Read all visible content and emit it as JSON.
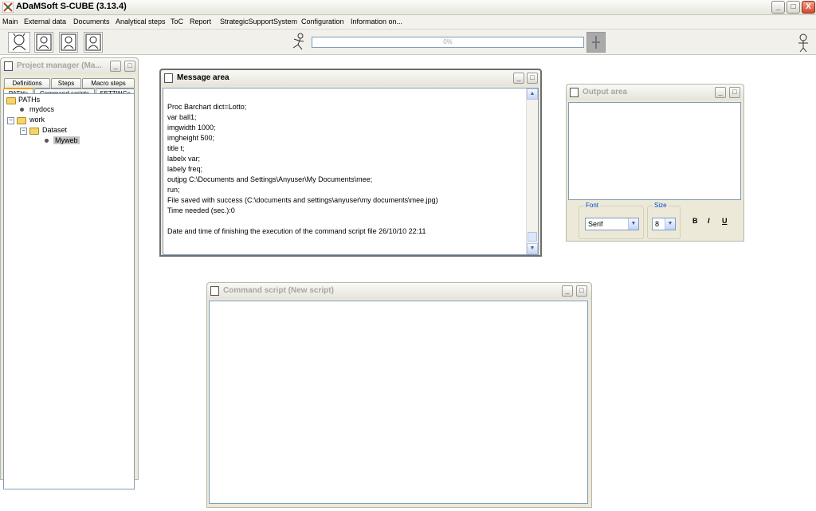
{
  "window": {
    "title": "ADaMSoft S-CUBE (3.13.4)",
    "controls": [
      "_",
      "□",
      "X"
    ]
  },
  "menu": [
    "Main",
    "External data",
    "Documents",
    "Analytical steps",
    "ToC",
    "Report",
    "StrategicSupportSystem",
    "Configuration",
    "Information on..."
  ],
  "toolbar": {
    "progress_text": "0%",
    "progress_value": 0
  },
  "project_manager": {
    "title": "Project manager (Ma...",
    "tabs_row1": [
      "Definitions",
      "Steps",
      "Macro steps"
    ],
    "tabs_row2": [
      "PATHs",
      "Command scripts",
      "SETTINGs"
    ],
    "selected_tab": "PATHs",
    "tree": {
      "root": "PATHs",
      "mydocs": "mydocs",
      "work": "work",
      "dataset": "Dataset",
      "myweb": "Myweb"
    }
  },
  "message_area": {
    "title": "Message area",
    "lines": [
      "Proc Barchart dict=Lotto;",
      "var ball1;",
      "imgwidth 1000;",
      "imgheight 500;",
      "title t;",
      "labelx var;",
      "labely freq;",
      "outjpg C:\\Documents and Settings\\Anyuser\\My Documents\\mee;",
      "run;",
      "File saved with success (C:\\documents and settings\\anyuser\\my documents\\mee.jpg)",
      "Time needed (sec.):0",
      "",
      "Date and time of finishing the execution of the command script file 26/10/10 22:11"
    ]
  },
  "output_area": {
    "title": "Output area",
    "font_label": "Font",
    "font_value": "Serif",
    "size_label": "Size",
    "size_value": "8",
    "bold": "B",
    "italic": "I",
    "underline": "U"
  },
  "command_script": {
    "title": "Command script (New script)"
  }
}
